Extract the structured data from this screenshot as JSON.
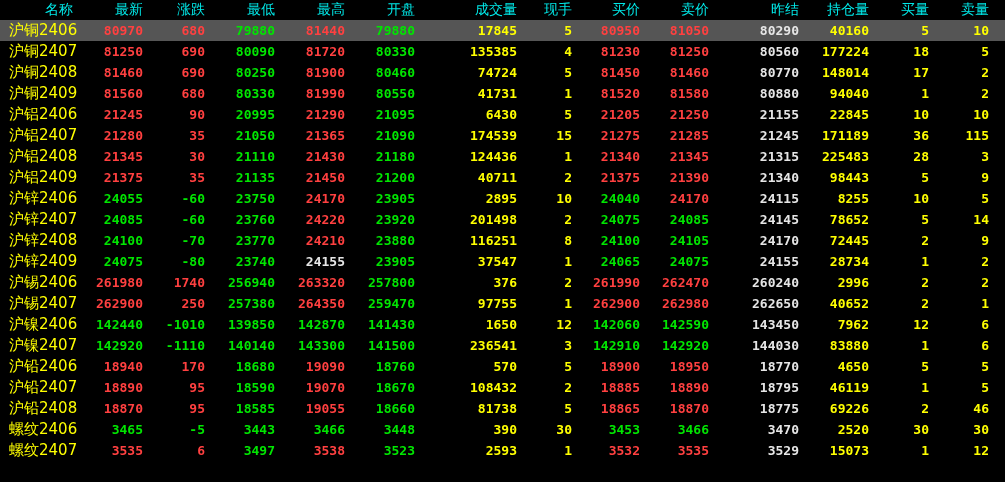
{
  "columns": [
    {
      "label": "名称",
      "kind": "name"
    },
    {
      "label": "最新",
      "kind": "price"
    },
    {
      "label": "涨跌",
      "kind": "price"
    },
    {
      "label": "最低",
      "kind": "price"
    },
    {
      "label": "最高",
      "kind": "price"
    },
    {
      "label": "开盘",
      "kind": "price"
    },
    {
      "label": "成交量",
      "kind": "volume"
    },
    {
      "label": "现手",
      "kind": "volume"
    },
    {
      "label": "买价",
      "kind": "price"
    },
    {
      "label": "卖价",
      "kind": "price"
    },
    {
      "label": "昨结",
      "kind": "settle"
    },
    {
      "label": "持仓量",
      "kind": "volume"
    },
    {
      "label": "买量",
      "kind": "volume"
    },
    {
      "label": "卖量",
      "kind": "volume"
    }
  ],
  "rows": [
    {
      "name": "沪铜2406",
      "selected": true,
      "cells": [
        {
          "text": "80970",
          "color": "#ff4040"
        },
        {
          "text": "680",
          "color": "#ff4040"
        },
        {
          "text": "79880",
          "color": "#00e600"
        },
        {
          "text": "81440",
          "color": "#ff4040"
        },
        {
          "text": "79880",
          "color": "#00e600"
        },
        {
          "text": "17845"
        },
        {
          "text": "5"
        },
        {
          "text": "80950",
          "color": "#ff4040"
        },
        {
          "text": "81050",
          "color": "#ff4040"
        },
        {
          "text": "80290"
        },
        {
          "text": "40160"
        },
        {
          "text": "5"
        },
        {
          "text": "10"
        }
      ]
    },
    {
      "name": "沪铜2407",
      "selected": false,
      "cells": [
        {
          "text": "81250",
          "color": "#ff4040"
        },
        {
          "text": "690",
          "color": "#ff4040"
        },
        {
          "text": "80090",
          "color": "#00e600"
        },
        {
          "text": "81720",
          "color": "#ff4040"
        },
        {
          "text": "80330",
          "color": "#00e600"
        },
        {
          "text": "135385"
        },
        {
          "text": "4"
        },
        {
          "text": "81230",
          "color": "#ff4040"
        },
        {
          "text": "81250",
          "color": "#ff4040"
        },
        {
          "text": "80560"
        },
        {
          "text": "177224"
        },
        {
          "text": "18"
        },
        {
          "text": "5"
        }
      ]
    },
    {
      "name": "沪铜2408",
      "selected": false,
      "cells": [
        {
          "text": "81460",
          "color": "#ff4040"
        },
        {
          "text": "690",
          "color": "#ff4040"
        },
        {
          "text": "80250",
          "color": "#00e600"
        },
        {
          "text": "81900",
          "color": "#ff4040"
        },
        {
          "text": "80460",
          "color": "#00e600"
        },
        {
          "text": "74724"
        },
        {
          "text": "5"
        },
        {
          "text": "81450",
          "color": "#ff4040"
        },
        {
          "text": "81460",
          "color": "#ff4040"
        },
        {
          "text": "80770"
        },
        {
          "text": "148014"
        },
        {
          "text": "17"
        },
        {
          "text": "2"
        }
      ]
    },
    {
      "name": "沪铜2409",
      "selected": false,
      "cells": [
        {
          "text": "81560",
          "color": "#ff4040"
        },
        {
          "text": "680",
          "color": "#ff4040"
        },
        {
          "text": "80330",
          "color": "#00e600"
        },
        {
          "text": "81990",
          "color": "#ff4040"
        },
        {
          "text": "80550",
          "color": "#00e600"
        },
        {
          "text": "41731"
        },
        {
          "text": "1"
        },
        {
          "text": "81520",
          "color": "#ff4040"
        },
        {
          "text": "81580",
          "color": "#ff4040"
        },
        {
          "text": "80880"
        },
        {
          "text": "94040"
        },
        {
          "text": "1"
        },
        {
          "text": "2"
        }
      ]
    },
    {
      "name": "沪铝2406",
      "selected": false,
      "cells": [
        {
          "text": "21245",
          "color": "#ff4040"
        },
        {
          "text": "90",
          "color": "#ff4040"
        },
        {
          "text": "20995",
          "color": "#00e600"
        },
        {
          "text": "21290",
          "color": "#ff4040"
        },
        {
          "text": "21095",
          "color": "#00e600"
        },
        {
          "text": "6430"
        },
        {
          "text": "5"
        },
        {
          "text": "21205",
          "color": "#ff4040"
        },
        {
          "text": "21250",
          "color": "#ff4040"
        },
        {
          "text": "21155"
        },
        {
          "text": "22845"
        },
        {
          "text": "10"
        },
        {
          "text": "10"
        }
      ]
    },
    {
      "name": "沪铝2407",
      "selected": false,
      "cells": [
        {
          "text": "21280",
          "color": "#ff4040"
        },
        {
          "text": "35",
          "color": "#ff4040"
        },
        {
          "text": "21050",
          "color": "#00e600"
        },
        {
          "text": "21365",
          "color": "#ff4040"
        },
        {
          "text": "21090",
          "color": "#00e600"
        },
        {
          "text": "174539"
        },
        {
          "text": "15"
        },
        {
          "text": "21275",
          "color": "#ff4040"
        },
        {
          "text": "21285",
          "color": "#ff4040"
        },
        {
          "text": "21245"
        },
        {
          "text": "171189"
        },
        {
          "text": "36"
        },
        {
          "text": "115"
        }
      ]
    },
    {
      "name": "沪铝2408",
      "selected": false,
      "cells": [
        {
          "text": "21345",
          "color": "#ff4040"
        },
        {
          "text": "30",
          "color": "#ff4040"
        },
        {
          "text": "21110",
          "color": "#00e600"
        },
        {
          "text": "21430",
          "color": "#ff4040"
        },
        {
          "text": "21180",
          "color": "#00e600"
        },
        {
          "text": "124436"
        },
        {
          "text": "1"
        },
        {
          "text": "21340",
          "color": "#ff4040"
        },
        {
          "text": "21345",
          "color": "#ff4040"
        },
        {
          "text": "21315"
        },
        {
          "text": "225483"
        },
        {
          "text": "28"
        },
        {
          "text": "3"
        }
      ]
    },
    {
      "name": "沪铝2409",
      "selected": false,
      "cells": [
        {
          "text": "21375",
          "color": "#ff4040"
        },
        {
          "text": "35",
          "color": "#ff4040"
        },
        {
          "text": "21135",
          "color": "#00e600"
        },
        {
          "text": "21450",
          "color": "#ff4040"
        },
        {
          "text": "21200",
          "color": "#00e600"
        },
        {
          "text": "40711"
        },
        {
          "text": "2"
        },
        {
          "text": "21375",
          "color": "#ff4040"
        },
        {
          "text": "21390",
          "color": "#ff4040"
        },
        {
          "text": "21340"
        },
        {
          "text": "98443"
        },
        {
          "text": "5"
        },
        {
          "text": "9"
        }
      ]
    },
    {
      "name": "沪锌2406",
      "selected": false,
      "cells": [
        {
          "text": "24055",
          "color": "#00e600"
        },
        {
          "text": "-60",
          "color": "#00e600"
        },
        {
          "text": "23750",
          "color": "#00e600"
        },
        {
          "text": "24170",
          "color": "#ff4040"
        },
        {
          "text": "23905",
          "color": "#00e600"
        },
        {
          "text": "2895"
        },
        {
          "text": "10"
        },
        {
          "text": "24040",
          "color": "#00e600"
        },
        {
          "text": "24170",
          "color": "#ff4040"
        },
        {
          "text": "24115"
        },
        {
          "text": "8255"
        },
        {
          "text": "10"
        },
        {
          "text": "5"
        }
      ]
    },
    {
      "name": "沪锌2407",
      "selected": false,
      "cells": [
        {
          "text": "24085",
          "color": "#00e600"
        },
        {
          "text": "-60",
          "color": "#00e600"
        },
        {
          "text": "23760",
          "color": "#00e600"
        },
        {
          "text": "24220",
          "color": "#ff4040"
        },
        {
          "text": "23920",
          "color": "#00e600"
        },
        {
          "text": "201498"
        },
        {
          "text": "2"
        },
        {
          "text": "24075",
          "color": "#00e600"
        },
        {
          "text": "24085",
          "color": "#00e600"
        },
        {
          "text": "24145"
        },
        {
          "text": "78652"
        },
        {
          "text": "5"
        },
        {
          "text": "14"
        }
      ]
    },
    {
      "name": "沪锌2408",
      "selected": false,
      "cells": [
        {
          "text": "24100",
          "color": "#00e600"
        },
        {
          "text": "-70",
          "color": "#00e600"
        },
        {
          "text": "23770",
          "color": "#00e600"
        },
        {
          "text": "24210",
          "color": "#ff4040"
        },
        {
          "text": "23880",
          "color": "#00e600"
        },
        {
          "text": "116251"
        },
        {
          "text": "8"
        },
        {
          "text": "24100",
          "color": "#00e600"
        },
        {
          "text": "24105",
          "color": "#00e600"
        },
        {
          "text": "24170"
        },
        {
          "text": "72445"
        },
        {
          "text": "2"
        },
        {
          "text": "9"
        }
      ]
    },
    {
      "name": "沪锌2409",
      "selected": false,
      "cells": [
        {
          "text": "24075",
          "color": "#00e600"
        },
        {
          "text": "-80",
          "color": "#00e600"
        },
        {
          "text": "23740",
          "color": "#00e600"
        },
        {
          "text": "24155",
          "color": "#e6e6e6"
        },
        {
          "text": "23905",
          "color": "#00e600"
        },
        {
          "text": "37547"
        },
        {
          "text": "1"
        },
        {
          "text": "24065",
          "color": "#00e600"
        },
        {
          "text": "24075",
          "color": "#00e600"
        },
        {
          "text": "24155"
        },
        {
          "text": "28734"
        },
        {
          "text": "1"
        },
        {
          "text": "2"
        }
      ]
    },
    {
      "name": "沪锡2406",
      "selected": false,
      "cells": [
        {
          "text": "261980",
          "color": "#ff4040"
        },
        {
          "text": "1740",
          "color": "#ff4040"
        },
        {
          "text": "256940",
          "color": "#00e600"
        },
        {
          "text": "263320",
          "color": "#ff4040"
        },
        {
          "text": "257800",
          "color": "#00e600"
        },
        {
          "text": "376"
        },
        {
          "text": "2"
        },
        {
          "text": "261990",
          "color": "#ff4040"
        },
        {
          "text": "262470",
          "color": "#ff4040"
        },
        {
          "text": "260240"
        },
        {
          "text": "2996"
        },
        {
          "text": "2"
        },
        {
          "text": "2"
        }
      ]
    },
    {
      "name": "沪锡2407",
      "selected": false,
      "cells": [
        {
          "text": "262900",
          "color": "#ff4040"
        },
        {
          "text": "250",
          "color": "#ff4040"
        },
        {
          "text": "257380",
          "color": "#00e600"
        },
        {
          "text": "264350",
          "color": "#ff4040"
        },
        {
          "text": "259470",
          "color": "#00e600"
        },
        {
          "text": "97755"
        },
        {
          "text": "1"
        },
        {
          "text": "262900",
          "color": "#ff4040"
        },
        {
          "text": "262980",
          "color": "#ff4040"
        },
        {
          "text": "262650"
        },
        {
          "text": "40652"
        },
        {
          "text": "2"
        },
        {
          "text": "1"
        }
      ]
    },
    {
      "name": "沪镍2406",
      "selected": false,
      "cells": [
        {
          "text": "142440",
          "color": "#00e600"
        },
        {
          "text": "-1010",
          "color": "#00e600"
        },
        {
          "text": "139850",
          "color": "#00e600"
        },
        {
          "text": "142870",
          "color": "#00e600"
        },
        {
          "text": "141430",
          "color": "#00e600"
        },
        {
          "text": "1650"
        },
        {
          "text": "12"
        },
        {
          "text": "142060",
          "color": "#00e600"
        },
        {
          "text": "142590",
          "color": "#00e600"
        },
        {
          "text": "143450"
        },
        {
          "text": "7962"
        },
        {
          "text": "12"
        },
        {
          "text": "6"
        }
      ]
    },
    {
      "name": "沪镍2407",
      "selected": false,
      "cells": [
        {
          "text": "142920",
          "color": "#00e600"
        },
        {
          "text": "-1110",
          "color": "#00e600"
        },
        {
          "text": "140140",
          "color": "#00e600"
        },
        {
          "text": "143300",
          "color": "#00e600"
        },
        {
          "text": "141500",
          "color": "#00e600"
        },
        {
          "text": "236541"
        },
        {
          "text": "3"
        },
        {
          "text": "142910",
          "color": "#00e600"
        },
        {
          "text": "142920",
          "color": "#00e600"
        },
        {
          "text": "144030"
        },
        {
          "text": "83880"
        },
        {
          "text": "1"
        },
        {
          "text": "6"
        }
      ]
    },
    {
      "name": "沪铅2406",
      "selected": false,
      "cells": [
        {
          "text": "18940",
          "color": "#ff4040"
        },
        {
          "text": "170",
          "color": "#ff4040"
        },
        {
          "text": "18680",
          "color": "#00e600"
        },
        {
          "text": "19090",
          "color": "#ff4040"
        },
        {
          "text": "18760",
          "color": "#00e600"
        },
        {
          "text": "570"
        },
        {
          "text": "5"
        },
        {
          "text": "18900",
          "color": "#ff4040"
        },
        {
          "text": "18950",
          "color": "#ff4040"
        },
        {
          "text": "18770"
        },
        {
          "text": "4650"
        },
        {
          "text": "5"
        },
        {
          "text": "5"
        }
      ]
    },
    {
      "name": "沪铅2407",
      "selected": false,
      "cells": [
        {
          "text": "18890",
          "color": "#ff4040"
        },
        {
          "text": "95",
          "color": "#ff4040"
        },
        {
          "text": "18590",
          "color": "#00e600"
        },
        {
          "text": "19070",
          "color": "#ff4040"
        },
        {
          "text": "18670",
          "color": "#00e600"
        },
        {
          "text": "108432"
        },
        {
          "text": "2"
        },
        {
          "text": "18885",
          "color": "#ff4040"
        },
        {
          "text": "18890",
          "color": "#ff4040"
        },
        {
          "text": "18795"
        },
        {
          "text": "46119"
        },
        {
          "text": "1"
        },
        {
          "text": "5"
        }
      ]
    },
    {
      "name": "沪铅2408",
      "selected": false,
      "cells": [
        {
          "text": "18870",
          "color": "#ff4040"
        },
        {
          "text": "95",
          "color": "#ff4040"
        },
        {
          "text": "18585",
          "color": "#00e600"
        },
        {
          "text": "19055",
          "color": "#ff4040"
        },
        {
          "text": "18660",
          "color": "#00e600"
        },
        {
          "text": "81738"
        },
        {
          "text": "5"
        },
        {
          "text": "18865",
          "color": "#ff4040"
        },
        {
          "text": "18870",
          "color": "#ff4040"
        },
        {
          "text": "18775"
        },
        {
          "text": "69226"
        },
        {
          "text": "2"
        },
        {
          "text": "46"
        }
      ]
    },
    {
      "name": "螺纹2406",
      "selected": false,
      "cells": [
        {
          "text": "3465",
          "color": "#00e600"
        },
        {
          "text": "-5",
          "color": "#00e600"
        },
        {
          "text": "3443",
          "color": "#00e600"
        },
        {
          "text": "3466",
          "color": "#00e600"
        },
        {
          "text": "3448",
          "color": "#00e600"
        },
        {
          "text": "390"
        },
        {
          "text": "30"
        },
        {
          "text": "3453",
          "color": "#00e600"
        },
        {
          "text": "3466",
          "color": "#00e600"
        },
        {
          "text": "3470"
        },
        {
          "text": "2520"
        },
        {
          "text": "30"
        },
        {
          "text": "30"
        }
      ]
    },
    {
      "name": "螺纹2407",
      "selected": false,
      "cells": [
        {
          "text": "3535",
          "color": "#ff4040"
        },
        {
          "text": "6",
          "color": "#ff4040"
        },
        {
          "text": "3497",
          "color": "#00e600"
        },
        {
          "text": "3538",
          "color": "#ff4040"
        },
        {
          "text": "3523",
          "color": "#00e600"
        },
        {
          "text": "2593"
        },
        {
          "text": "1"
        },
        {
          "text": "3532",
          "color": "#ff4040"
        },
        {
          "text": "3535",
          "color": "#ff4040"
        },
        {
          "text": "3529"
        },
        {
          "text": "15073"
        },
        {
          "text": "1"
        },
        {
          "text": "12"
        }
      ]
    }
  ]
}
